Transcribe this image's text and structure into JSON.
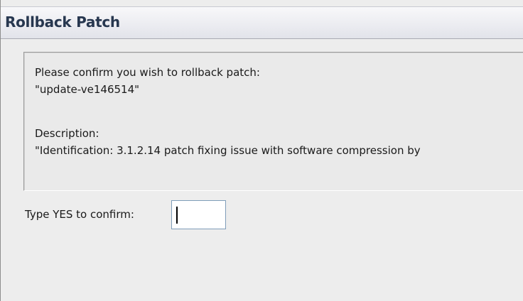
{
  "dialog": {
    "title": "Rollback Patch"
  },
  "info": {
    "prompt": "Please confirm you wish to rollback patch:",
    "patch_name": "\"update-ve146514\"",
    "description_label": "Description:",
    "description_text": "\"Identification: 3.1.2.14 patch fixing issue with software compression by"
  },
  "confirm": {
    "label": "Type YES to confirm:",
    "value": ""
  }
}
